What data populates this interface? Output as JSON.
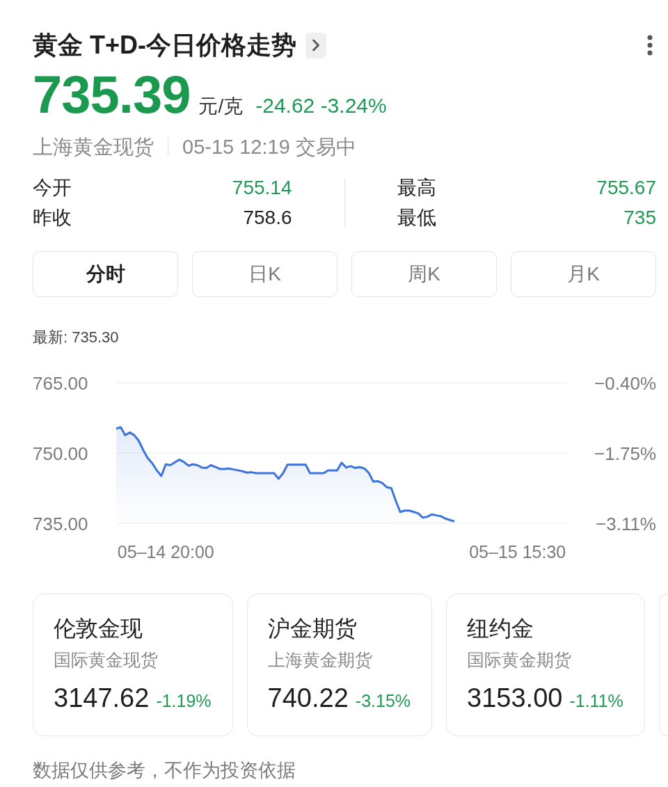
{
  "header": {
    "title": "黄金 T+D-今日价格走势"
  },
  "quote": {
    "price": "735.39",
    "unit": "元/克",
    "change": "-24.62 -3.24%",
    "market": "上海黄金现货",
    "time_status": "05-15 12:19 交易中"
  },
  "stat_columns": [
    [
      {
        "label": "今开",
        "value": "755.14",
        "color": "#1f9a55"
      },
      {
        "label": "昨收",
        "value": "758.6",
        "color": "#222222"
      }
    ],
    [
      {
        "label": "最高",
        "value": "755.67",
        "color": "#1f9a55"
      },
      {
        "label": "最低",
        "value": "735",
        "color": "#1f9a55"
      }
    ]
  ],
  "tabs": [
    {
      "label": "分时",
      "selected": true
    },
    {
      "label": "日K",
      "selected": false
    },
    {
      "label": "周K",
      "selected": false
    },
    {
      "label": "月K",
      "selected": false
    }
  ],
  "chart": {
    "latest": "最新: 735.30",
    "percent_ticks": [
      "−0.40%",
      "−1.75%",
      "−3.11%"
    ],
    "chart_data": {
      "type": "area",
      "categories": [
        null,
        null,
        null,
        null,
        null,
        null,
        null,
        null,
        null,
        null,
        null,
        "05–14 20:00",
        null,
        null,
        null,
        null,
        null,
        null,
        null,
        null,
        null,
        null,
        null,
        null,
        null,
        null,
        null,
        null,
        null,
        null,
        null,
        null,
        null,
        null,
        null,
        null,
        null,
        null,
        null,
        null,
        null,
        null,
        null,
        null,
        null,
        null,
        null,
        null,
        null,
        null,
        null,
        null,
        null,
        null,
        null,
        null,
        null,
        null,
        null,
        null,
        null,
        null,
        null,
        null,
        null,
        null,
        null,
        null,
        null,
        null,
        null,
        null,
        null,
        null,
        null,
        null,
        null,
        null,
        null,
        null,
        null,
        null,
        null,
        null,
        null,
        null,
        null,
        null,
        null,
        "05–15 15:30",
        null,
        null,
        null,
        null,
        null,
        null,
        null,
        null,
        null,
        null,
        null
      ],
      "series": [
        {
          "color": "#3a74dc",
          "values": [
            755.2,
            755.5,
            753.8,
            754.4,
            753.8,
            752.6,
            750.6,
            748.9,
            747.8,
            746.3,
            745.1,
            747.6,
            747.4,
            748.0,
            748.6,
            748.1,
            747.3,
            747.6,
            747.4,
            746.9,
            746.8,
            747.4,
            747.0,
            746.6,
            746.6,
            746.7,
            746.5,
            746.3,
            746.1,
            745.8,
            745.9,
            745.7,
            745.7,
            745.7,
            745.7,
            745.7,
            744.5,
            745.7,
            747.5,
            747.5,
            747.5,
            747.5,
            747.5,
            745.7,
            745.7,
            745.7,
            745.7,
            746.3,
            746.3,
            746.3,
            747.9,
            746.9,
            747.2,
            746.8,
            747.0,
            746.7,
            745.8,
            743.9,
            744.0,
            743.6,
            742.7,
            742.5,
            739.8,
            737.4,
            737.7,
            737.7,
            737.4,
            737.1,
            736.2,
            736.4,
            736.9,
            736.7,
            736.5,
            736.0,
            735.7,
            735.4,
            null,
            null,
            null,
            null,
            null,
            null,
            null,
            null,
            null,
            null,
            null,
            null,
            null,
            null,
            null,
            null,
            null,
            null,
            null,
            null,
            null,
            null,
            null,
            null,
            null
          ]
        }
      ],
      "ylim": [
        735,
        765
      ],
      "yticks": [
        {
          "value": 765,
          "label": "765.00"
        },
        {
          "value": 750,
          "label": "750.00"
        },
        {
          "value": 735,
          "label": "735.00"
        }
      ]
    }
  },
  "cards": [
    {
      "title": "伦敦金现",
      "subtitle": "国际黄金现货",
      "price": "3147.62",
      "change": "-1.19%"
    },
    {
      "title": "沪金期货",
      "subtitle": "上海黄金期货",
      "price": "740.22",
      "change": "-3.15%"
    },
    {
      "title": "纽约金",
      "subtitle": "国际黄金期货",
      "price": "3153.00",
      "change": "-1.11%"
    }
  ],
  "next_card_peek": true,
  "footer": "数据仅供参考，不作为投资依据"
}
